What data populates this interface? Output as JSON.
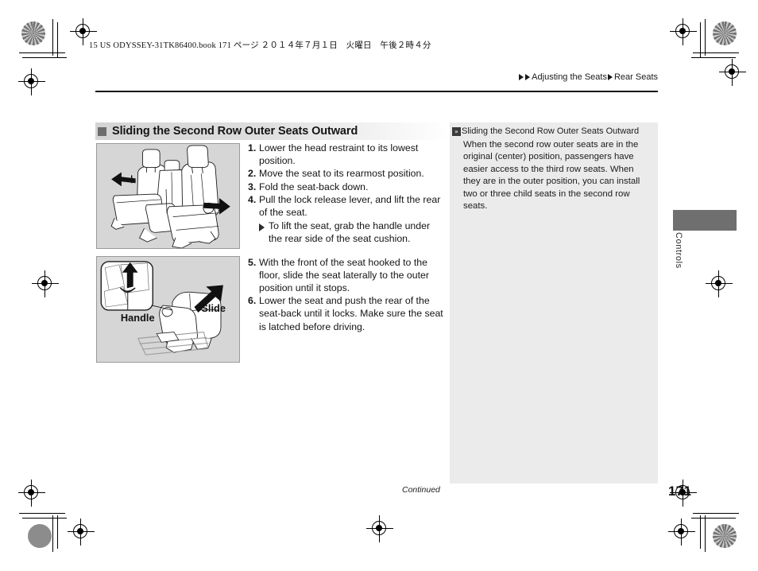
{
  "document": {
    "print_header": "15 US ODYSSEY-31TK86400.book  171 ページ  ２０１４年７月１日　火曜日　午後２時４分",
    "breadcrumb": {
      "segment_1": "Adjusting the Seats",
      "segment_2": "Rear Seats"
    },
    "page_number": "171",
    "continued_label": "Continued",
    "side_tab_label": "Controls"
  },
  "section": {
    "heading": "Sliding the Second Row Outer Seats Outward"
  },
  "steps": [
    {
      "num": "1.",
      "text": "Lower the head restraint to its lowest position."
    },
    {
      "num": "2.",
      "text": "Move the seat to its rearmost position."
    },
    {
      "num": "3.",
      "text": "Fold the seat-back down."
    },
    {
      "num": "4.",
      "text": "Pull the lock release lever, and lift the rear of the seat."
    }
  ],
  "substep": {
    "text": "To lift the seat, grab the handle under the rear side of the seat cushion."
  },
  "steps_2": [
    {
      "num": "5.",
      "text": "With the front of the seat hooked to the floor, slide the seat laterally to the outer position until it stops."
    },
    {
      "num": "6.",
      "text": "Lower the seat and push the rear of the seat-back until it locks. Make sure the seat is latched before driving."
    }
  ],
  "note": {
    "badge": "»",
    "title": "Sliding the Second Row Outer Seats Outward",
    "body": "When the second row outer seats are in the original (center) position, passengers have easier access to the third row seats. When they are in the outer position, you can install two or three child seats in the second row seats."
  },
  "figures": {
    "figure_1": {
      "name": "second-row-seats-sliding-outward-illustration",
      "callouts": []
    },
    "figure_2": {
      "name": "seat-handle-and-slide-illustration",
      "callouts": [
        "Handle",
        "Slide"
      ]
    }
  },
  "colors": {
    "heading_band_start": "#d4d4d4",
    "note_background": "#ebebeb",
    "figure_background": "#d6d6d6",
    "tab_block": "#6f6f6f",
    "bullet_square": "#6d6d6d"
  }
}
